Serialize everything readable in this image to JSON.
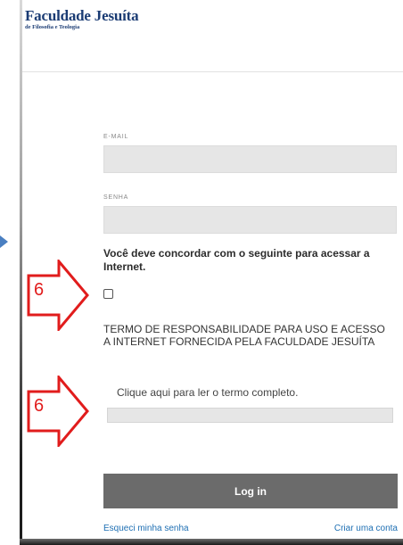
{
  "header": {
    "logo_title": "Faculdade Jesuíta",
    "logo_subtitle": "de Filosofia e Teologia"
  },
  "form": {
    "email_label": "E-MAIL",
    "email_value": "",
    "password_label": "SENHA",
    "password_value": "",
    "agree_text": "Você deve concordar com o seguinte para acessar a Internet.",
    "checkbox_checked": false,
    "terms_title": "TERMO DE RESPONSABILIDADE PARA USO E ACESSO A INTERNET FORNECIDA PELA FACULDADE JESUÍTA",
    "terms_link": "Clique aqui para ler o termo completo.",
    "login_button": "Log in",
    "forgot_password": "Esqueci minha senha",
    "create_account": "Criar uma conta"
  },
  "annotations": {
    "callout_1": "6",
    "callout_2": "6",
    "callout_color": "#e11c1c"
  },
  "colors": {
    "brand": "#1b3c74",
    "link": "#1e6fb3",
    "button": "#6b6b6b",
    "input_bg": "#e6e6e6"
  }
}
